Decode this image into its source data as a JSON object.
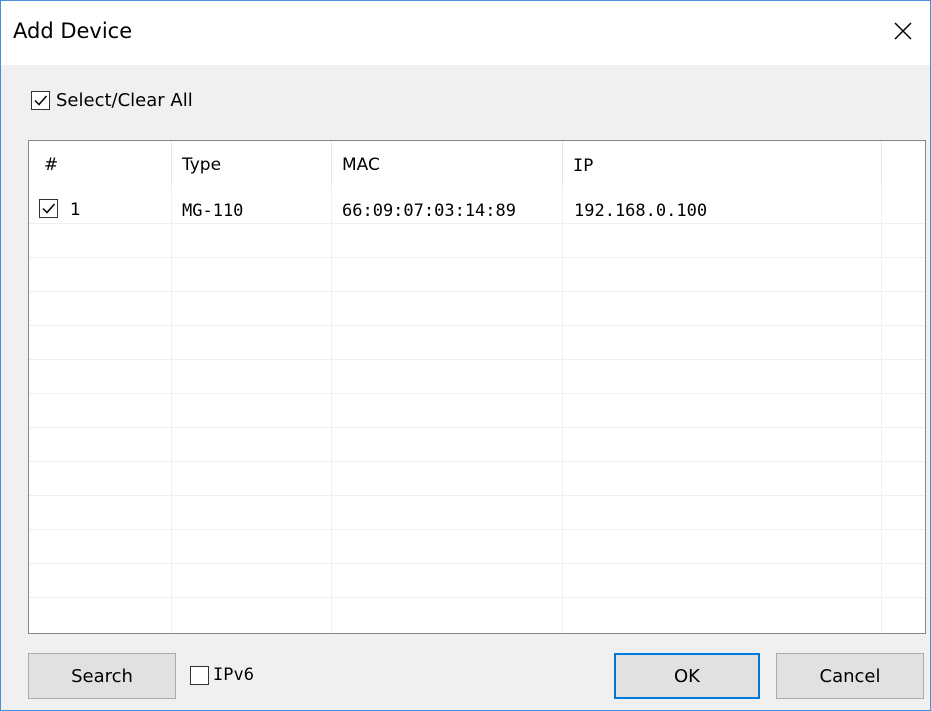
{
  "dialog": {
    "title": "Add Device",
    "select_all_label": "Select/Clear All",
    "select_all_checked": true
  },
  "table": {
    "columns": [
      "#",
      "Type",
      "MAC",
      "IP"
    ],
    "rows": [
      {
        "index": "1",
        "checked": true,
        "type": "MG-110",
        "mac": "66:09:07:03:14:89",
        "ip": "192.168.0.100"
      }
    ]
  },
  "footer": {
    "search_label": "Search",
    "ipv6_label": "IPv6",
    "ipv6_checked": false,
    "ok_label": "OK",
    "cancel_label": "Cancel"
  },
  "icons": {
    "close": "close-icon",
    "check": "checkmark-icon"
  },
  "colors": {
    "accent": "#0078d7",
    "window_border": "#4a90d9",
    "dialog_background": "#f0f0f0"
  }
}
